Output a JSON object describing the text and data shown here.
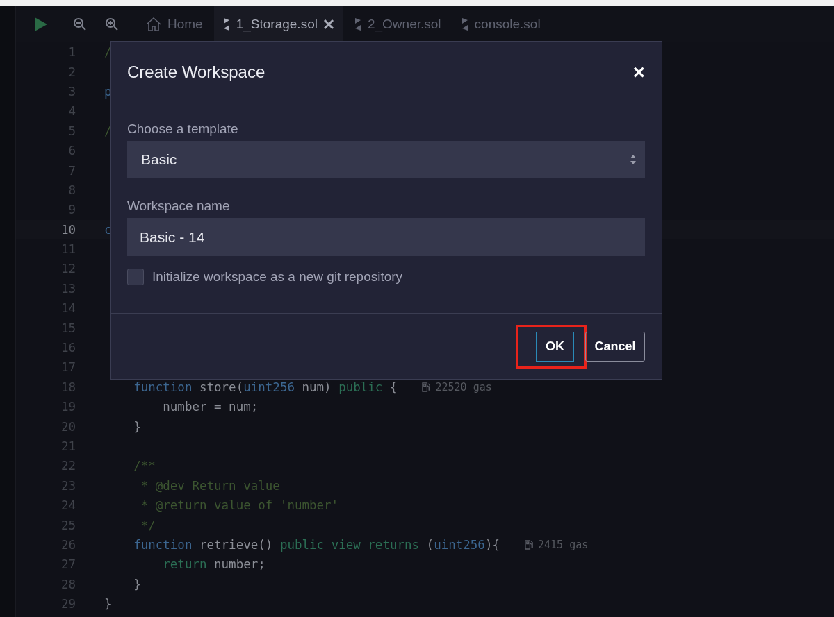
{
  "toolbar": {
    "tabs": [
      {
        "kind": "home",
        "label": "Home",
        "selected": false,
        "closable": false
      },
      {
        "kind": "file",
        "label": "1_Storage.sol",
        "selected": true,
        "closable": true
      },
      {
        "kind": "file",
        "label": "2_Owner.sol",
        "selected": false,
        "closable": false
      },
      {
        "kind": "file",
        "label": "console.sol",
        "selected": false,
        "closable": false
      }
    ]
  },
  "editor": {
    "lines": [
      {
        "number": "1",
        "current": false,
        "tokens": [
          {
            "kind": "comment",
            "text": "/"
          }
        ]
      },
      {
        "number": "2",
        "current": false
      },
      {
        "number": "3",
        "current": false,
        "tokens": [
          {
            "kind": "type",
            "text": "p"
          }
        ]
      },
      {
        "number": "4",
        "current": false
      },
      {
        "number": "5",
        "current": false,
        "tokens": [
          {
            "kind": "comment",
            "text": "/"
          }
        ]
      },
      {
        "number": "6",
        "current": false
      },
      {
        "number": "7",
        "current": false
      },
      {
        "number": "8",
        "current": false
      },
      {
        "number": "9",
        "current": false
      },
      {
        "number": "10",
        "current": true,
        "tokens": [
          {
            "kind": "type",
            "text": "c"
          }
        ]
      },
      {
        "number": "11",
        "current": false
      },
      {
        "number": "12",
        "current": false
      },
      {
        "number": "13",
        "current": false
      },
      {
        "number": "14",
        "current": false
      },
      {
        "number": "15",
        "current": false
      },
      {
        "number": "16",
        "current": false
      },
      {
        "number": "17",
        "current": false
      },
      {
        "number": "18",
        "current": false,
        "tokens": [
          {
            "kind": "keyword",
            "text": "    function"
          },
          {
            "kind": "plain",
            "text": " store("
          },
          {
            "kind": "type",
            "text": "uint256"
          },
          {
            "kind": "plain",
            "text": " num) "
          },
          {
            "kind": "modifier",
            "text": "public"
          },
          {
            "kind": "plain",
            "text": " {"
          }
        ],
        "gas": "22520 gas"
      },
      {
        "number": "19",
        "current": false,
        "tokens": [
          {
            "kind": "plain",
            "text": "        number = num;"
          }
        ]
      },
      {
        "number": "20",
        "current": false,
        "tokens": [
          {
            "kind": "plain",
            "text": "    }"
          }
        ]
      },
      {
        "number": "21",
        "current": false
      },
      {
        "number": "22",
        "current": false,
        "tokens": [
          {
            "kind": "comment",
            "text": "    /**"
          }
        ]
      },
      {
        "number": "23",
        "current": false,
        "tokens": [
          {
            "kind": "comment",
            "text": "     * @dev Return value"
          }
        ]
      },
      {
        "number": "24",
        "current": false,
        "tokens": [
          {
            "kind": "comment",
            "text": "     * @return value of 'number'"
          }
        ]
      },
      {
        "number": "25",
        "current": false,
        "tokens": [
          {
            "kind": "comment",
            "text": "     */"
          }
        ]
      },
      {
        "number": "26",
        "current": false,
        "tokens": [
          {
            "kind": "keyword",
            "text": "    function"
          },
          {
            "kind": "plain",
            "text": " retrieve() "
          },
          {
            "kind": "modifier",
            "text": "public view returns"
          },
          {
            "kind": "plain",
            "text": " ("
          },
          {
            "kind": "type",
            "text": "uint256"
          },
          {
            "kind": "plain",
            "text": "){"
          }
        ],
        "gas": "2415 gas"
      },
      {
        "number": "27",
        "current": false,
        "tokens": [
          {
            "kind": "modifier",
            "text": "        return"
          },
          {
            "kind": "plain",
            "text": " number;"
          }
        ]
      },
      {
        "number": "28",
        "current": false,
        "tokens": [
          {
            "kind": "plain",
            "text": "    }"
          }
        ]
      },
      {
        "number": "29",
        "current": false,
        "tokens": [
          {
            "kind": "plain",
            "text": "}"
          }
        ]
      }
    ]
  },
  "dialog": {
    "title": "Create Workspace",
    "close": "×",
    "template": {
      "label": "Choose a template",
      "value": "Basic"
    },
    "name": {
      "label": "Workspace name",
      "value": "Basic - 14"
    },
    "git": {
      "label": "Initialize workspace as a new git repository",
      "checked": false
    },
    "buttons": [
      {
        "kind": "primary",
        "label": "OK",
        "highlighted": true
      },
      {
        "kind": "secondary",
        "label": "Cancel",
        "highlighted": false
      }
    ]
  }
}
